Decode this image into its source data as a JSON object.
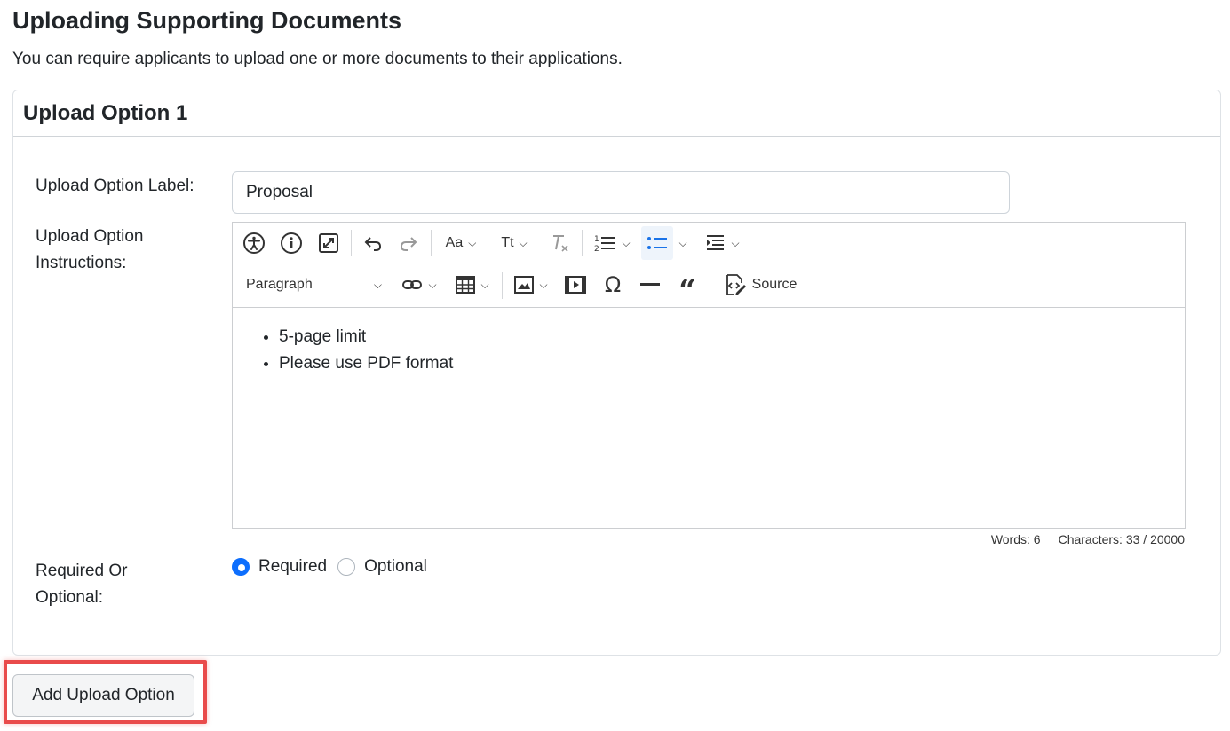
{
  "page": {
    "title": "Uploading Supporting Documents",
    "description": "You can require applicants to upload one or more documents to their applications."
  },
  "card": {
    "title": "Upload Option 1",
    "label_field": {
      "label": "Upload Option Label:",
      "value": "Proposal"
    },
    "instructions_field": {
      "label_line1": "Upload Option",
      "label_line2": "Instructions:"
    },
    "toolbar": {
      "heading_select": "Paragraph",
      "source_label": "Source",
      "font_family_label": "Aa",
      "font_size_label": "Tt"
    },
    "editor_content": [
      "5-page limit",
      "Please use PDF format"
    ],
    "counter": {
      "words": "Words: 6",
      "characters": "Characters: 33 / 20000"
    },
    "required_field": {
      "label_line1": "Required Or",
      "label_line2": "Optional:",
      "options": [
        "Required",
        "Optional"
      ],
      "selected": "Required"
    }
  },
  "add_button": {
    "label": "Add Upload Option"
  },
  "colors": {
    "accent": "#0d6efd",
    "highlight": "#e94b4b"
  }
}
